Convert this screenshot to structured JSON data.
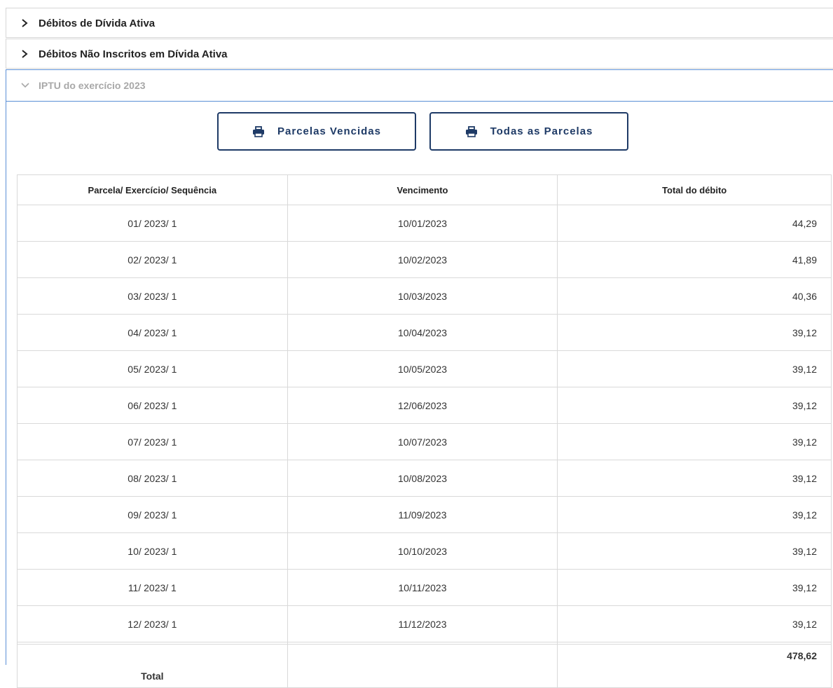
{
  "accordion": [
    {
      "title": "Débitos de Dívida Ativa",
      "state": "collapsed"
    },
    {
      "title": "Débitos Não Inscritos em Dívida Ativa",
      "state": "collapsed"
    },
    {
      "title": "IPTU do exercício 2023",
      "state": "expanded"
    }
  ],
  "buttons": {
    "overdue": "Parcelas Vencidas",
    "all": "Todas as Parcelas"
  },
  "table": {
    "headers": [
      "Parcela/ Exercício/ Sequência",
      "Vencimento",
      "Total do débito"
    ],
    "rows": [
      {
        "parcela": "01/ 2023/ 1",
        "vencimento": "10/01/2023",
        "total": "44,29"
      },
      {
        "parcela": "02/ 2023/ 1",
        "vencimento": "10/02/2023",
        "total": "41,89"
      },
      {
        "parcela": "03/ 2023/ 1",
        "vencimento": "10/03/2023",
        "total": "40,36"
      },
      {
        "parcela": "04/ 2023/ 1",
        "vencimento": "10/04/2023",
        "total": "39,12"
      },
      {
        "parcela": "05/ 2023/ 1",
        "vencimento": "10/05/2023",
        "total": "39,12"
      },
      {
        "parcela": "06/ 2023/ 1",
        "vencimento": "12/06/2023",
        "total": "39,12"
      },
      {
        "parcela": "07/ 2023/ 1",
        "vencimento": "10/07/2023",
        "total": "39,12"
      },
      {
        "parcela": "08/ 2023/ 1",
        "vencimento": "10/08/2023",
        "total": "39,12"
      },
      {
        "parcela": "09/ 2023/ 1",
        "vencimento": "11/09/2023",
        "total": "39,12"
      },
      {
        "parcela": "10/ 2023/ 1",
        "vencimento": "10/10/2023",
        "total": "39,12"
      },
      {
        "parcela": "11/ 2023/ 1",
        "vencimento": "10/11/2023",
        "total": "39,12"
      },
      {
        "parcela": "12/ 2023/ 1",
        "vencimento": "11/12/2023",
        "total": "39,12"
      }
    ],
    "total_label": "Total",
    "total_value": "478,62"
  },
  "icons": {
    "collapsed": "chevron-right-icon",
    "expanded": "chevron-down-icon",
    "button": "printer-icon"
  },
  "colors": {
    "button_border": "#1e3a66",
    "active_border": "#5b8fd6",
    "muted_title": "#a8a8a8"
  }
}
